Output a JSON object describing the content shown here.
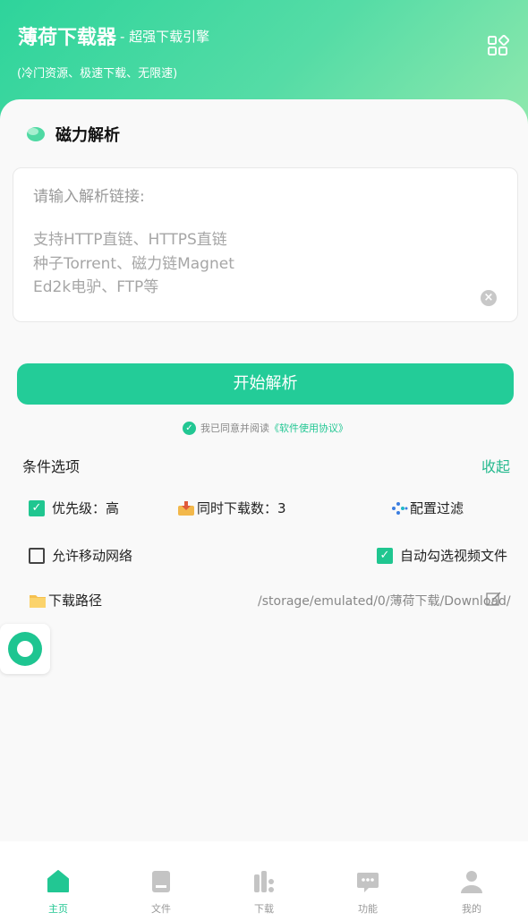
{
  "header": {
    "title": "薄荷下载器",
    "subtitle": "- 超强下载引擎",
    "tagline": "(冷门资源、极速下载、无限速)"
  },
  "section": {
    "title": "磁力解析"
  },
  "input": {
    "placeholder": "请输入解析链接:",
    "hints": [
      "支持HTTP直链、HTTPS直链",
      "种子Torrent、磁力链Magnet",
      "Ed2k电驴、FTP等"
    ]
  },
  "parse_button": "开始解析",
  "agreement": {
    "text": "我已同意并阅读",
    "link": "《软件使用协议》"
  },
  "options": {
    "title": "条件选项",
    "collapse": "收起",
    "priority": "优先级：高",
    "concurrent": "同时下载数：3",
    "filter": "配置过滤",
    "mobile_network": "允许移动网络",
    "auto_select_video": "自动勾选视频文件",
    "path_label": "下载路径",
    "path_value": "/storage/emulated/0/薄荷下载/Download/"
  },
  "tabs": [
    {
      "label": "主页",
      "active": true
    },
    {
      "label": "文件",
      "active": false
    },
    {
      "label": "下载",
      "active": false
    },
    {
      "label": "功能",
      "active": false
    },
    {
      "label": "我的",
      "active": false
    }
  ],
  "colors": {
    "accent": "#22c793",
    "header_start": "#2ed49b",
    "header_end": "#8fe8ad"
  }
}
